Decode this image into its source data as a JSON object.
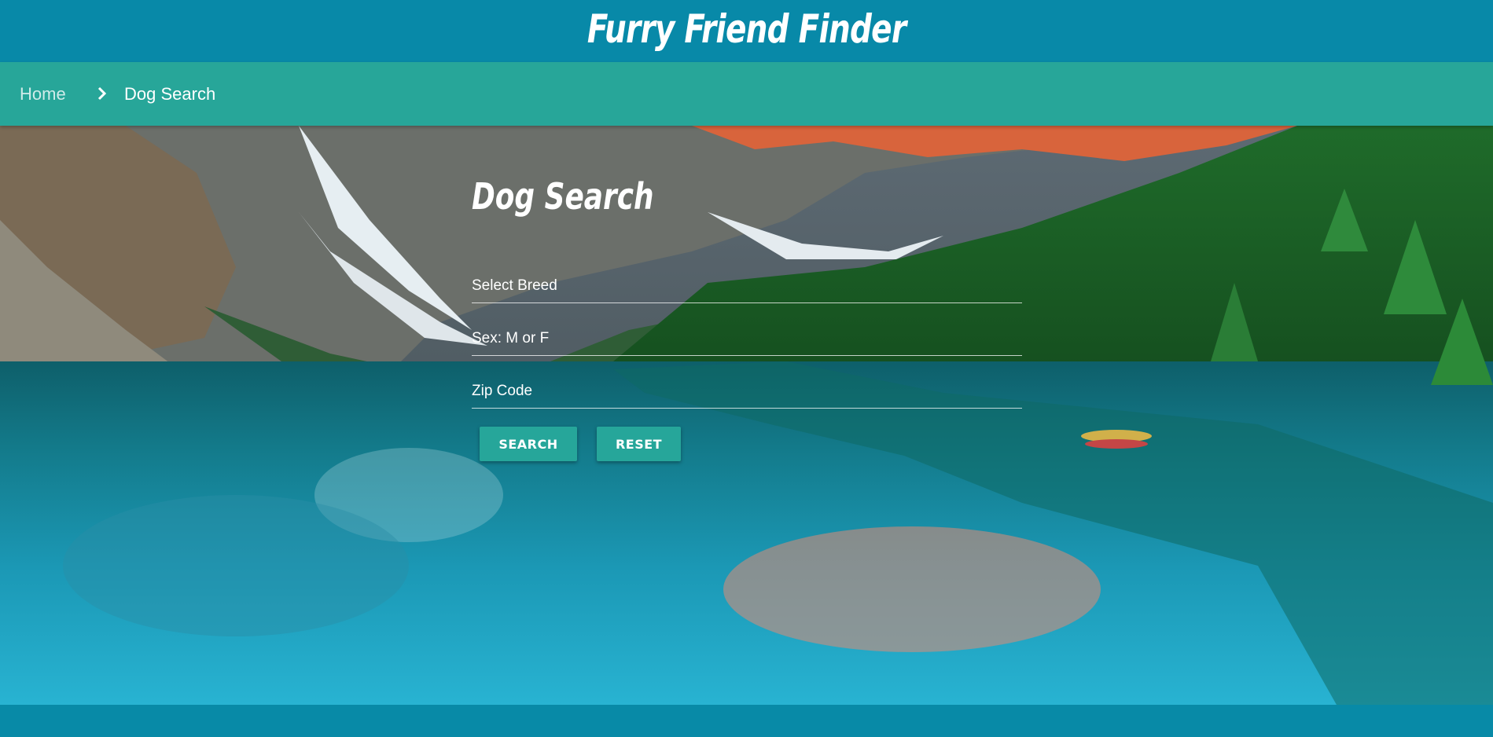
{
  "header": {
    "brand": "Furry Friend Finder"
  },
  "breadcrumb": {
    "home_label": "Home",
    "separator_icon": "chevron-right-icon",
    "current_label": "Dog Search"
  },
  "search": {
    "title": "Dog Search",
    "breed_placeholder": "Select Breed",
    "sex_placeholder": "Sex: M or F",
    "zip_placeholder": "Zip Code",
    "search_label": "SEARCH",
    "reset_label": "RESET"
  },
  "hero": {
    "image": "mountain-lake-landscape"
  },
  "colors": {
    "header_bg": "#0889a8",
    "breadcrumb_bg": "#27a699",
    "button_bg": "#26a69a",
    "text": "#ffffff"
  }
}
